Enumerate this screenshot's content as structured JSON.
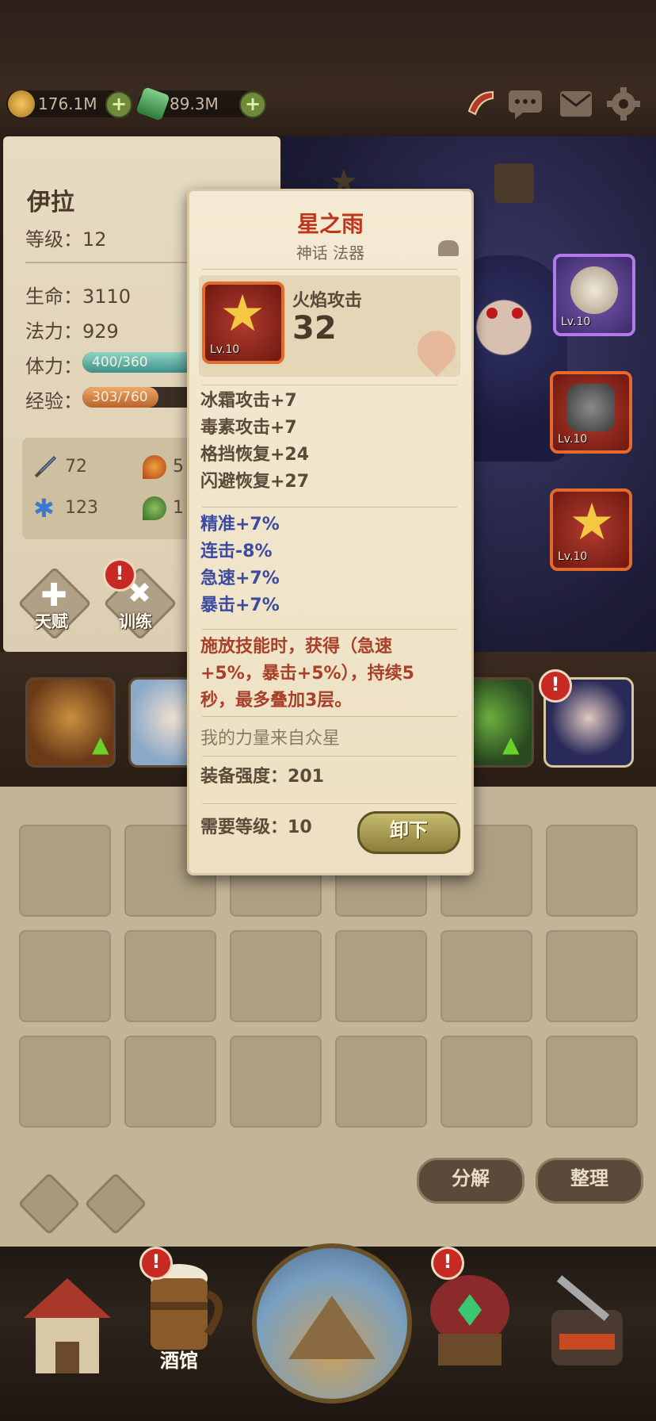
{
  "currencies": [
    {
      "name": "gold",
      "value": "176.1M",
      "color": "#d9a441"
    },
    {
      "name": "gems",
      "value": "89.3M",
      "color": "#4a9a5a"
    }
  ],
  "top_icons": [
    "horn-icon",
    "chat-icon",
    "mail-icon",
    "gear-icon"
  ],
  "hero": {
    "name": "伊拉",
    "level_label": "等级：",
    "level": "12",
    "hp_label": "生命：",
    "hp": "3110",
    "mana_label": "法力：",
    "mana": "929",
    "stamina_label": "体力：",
    "stamina": "400/360",
    "stamina_fraction": 1.0,
    "exp_label": "经验：",
    "exp": "303/760",
    "exp_fraction": 0.4,
    "stats": {
      "attack": "72",
      "fire": "5",
      "frost": "123",
      "poison": "1"
    },
    "talent_label": "天赋",
    "training_label": "训练"
  },
  "equipment_slots": [
    {
      "level": "Lv.10",
      "rarity": "purple"
    },
    {
      "level": "Lv.10",
      "rarity": "red"
    },
    {
      "level": "Lv.10",
      "rarity": "red"
    }
  ],
  "tooltip": {
    "title": "星之雨",
    "subtitle": "神话 法器",
    "item_level": "Lv.10",
    "main_stat_label": "火焰攻击",
    "main_stat_value": "32",
    "stats": [
      "冰霜攻击+7",
      "毒素攻击+7",
      "格挡恢复+24",
      "闪避恢复+27"
    ],
    "bonus_stats": [
      "精准+7%",
      "连击-8%",
      "急速+7%",
      "暴击+7%"
    ],
    "effect": "施放技能时，获得（急速+5%，暴击+5%），持续5秒，最多叠加3层。",
    "flavor": "我的力量来自众星",
    "power_label": "装备强度：",
    "power": "201",
    "req_label": "需要等级：",
    "req_level": "10",
    "unequip_label": "卸下"
  },
  "inventory": {
    "decompose_label": "分解",
    "sort_label": "整理"
  },
  "bottom_nav": {
    "tavern_label": "酒馆"
  }
}
